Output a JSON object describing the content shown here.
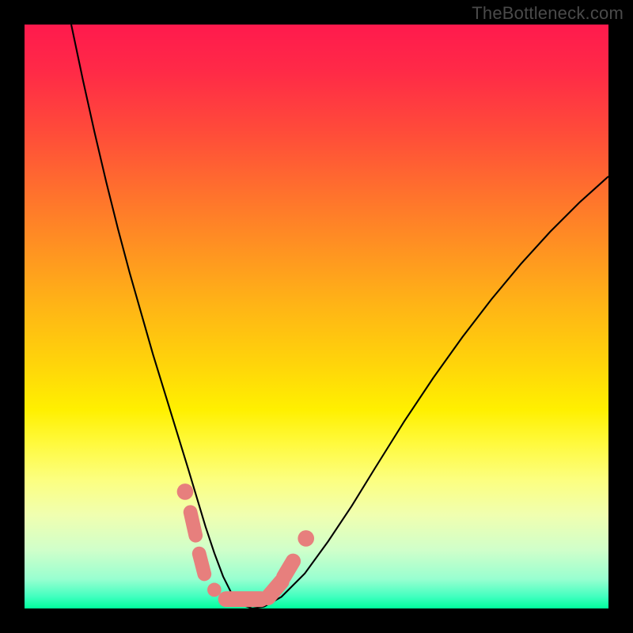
{
  "watermark": "TheBottleneck.com",
  "chart_data": {
    "type": "line",
    "title": "",
    "xlabel": "",
    "ylabel": "",
    "xlim": [
      0,
      100
    ],
    "ylim": [
      0,
      100
    ],
    "series": [
      {
        "name": "curve",
        "x": [
          8,
          10,
          12,
          14,
          16,
          18,
          20,
          22,
          24,
          26,
          28,
          29.5,
          31,
          32.5,
          34,
          35.5,
          37,
          39,
          41,
          44,
          48,
          52,
          56,
          60,
          65,
          70,
          75,
          80,
          85,
          90,
          95,
          100
        ],
        "y": [
          100,
          90.5,
          81.5,
          73,
          65,
          57.5,
          50.5,
          43.5,
          37,
          30.5,
          24,
          19,
          14,
          9.5,
          5.5,
          2.5,
          0.7,
          0,
          0.3,
          2,
          6,
          11.5,
          17.5,
          24,
          32,
          39.5,
          46.5,
          53,
          59,
          64.5,
          69.5,
          74
        ]
      }
    ],
    "markers": [
      {
        "type": "circle",
        "x": 27.5,
        "y": 20,
        "r": 1.4
      },
      {
        "type": "capsule",
        "x0": 28.4,
        "y0": 16.5,
        "x1": 29.3,
        "y1": 12.5,
        "r": 1.2
      },
      {
        "type": "capsule",
        "x0": 29.9,
        "y0": 9.4,
        "x1": 30.8,
        "y1": 5.9,
        "r": 1.2
      },
      {
        "type": "circle",
        "x": 32.5,
        "y": 3.2,
        "r": 1.2
      },
      {
        "type": "capsule",
        "x0": 34.5,
        "y0": 1.6,
        "x1": 40.5,
        "y1": 1.6,
        "r": 1.35
      },
      {
        "type": "capsule",
        "x0": 41.7,
        "y0": 1.9,
        "x1": 44.0,
        "y1": 4.6,
        "r": 1.35
      },
      {
        "type": "capsule",
        "x0": 44.4,
        "y0": 5.4,
        "x1": 46.0,
        "y1": 8.1,
        "r": 1.3
      },
      {
        "type": "circle",
        "x": 48.2,
        "y": 12.0,
        "r": 1.4
      }
    ],
    "colors": {
      "curve": "#000000",
      "markers": "#e77f7d"
    }
  }
}
